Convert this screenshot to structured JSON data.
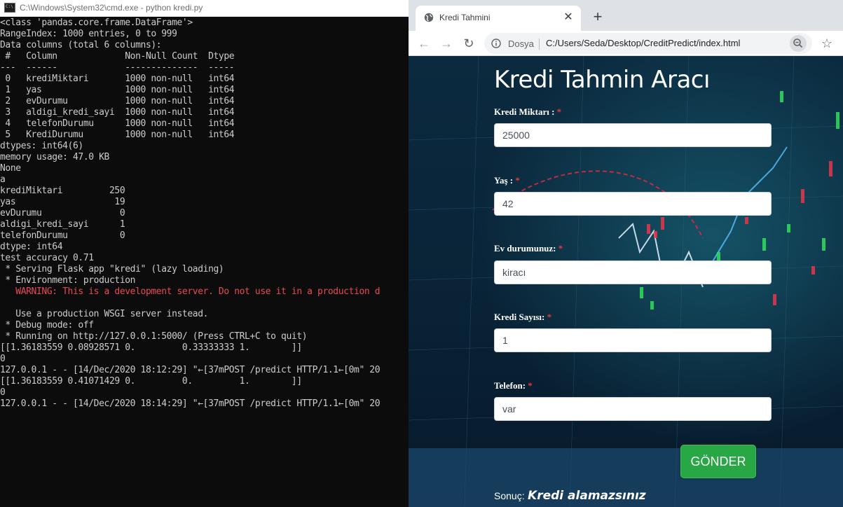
{
  "cmd": {
    "title": "C:\\Windows\\System32\\cmd.exe - python  kredi.py",
    "lines": [
      {
        "text": "<class 'pandas.core.frame.DataFrame'>",
        "type": "normal"
      },
      {
        "text": "RangeIndex: 1000 entries, 0 to 999",
        "type": "normal"
      },
      {
        "text": "Data columns (total 6 columns):",
        "type": "normal"
      },
      {
        "text": " #   Column             Non-Null Count  Dtype",
        "type": "normal"
      },
      {
        "text": "---  ------             --------------  -----",
        "type": "normal"
      },
      {
        "text": " 0   krediMiktari       1000 non-null   int64",
        "type": "normal"
      },
      {
        "text": " 1   yas                1000 non-null   int64",
        "type": "normal"
      },
      {
        "text": " 2   evDurumu           1000 non-null   int64",
        "type": "normal"
      },
      {
        "text": " 3   aldigi_kredi_sayi  1000 non-null   int64",
        "type": "normal"
      },
      {
        "text": " 4   telefonDurumu      1000 non-null   int64",
        "type": "normal"
      },
      {
        "text": " 5   KrediDurumu        1000 non-null   int64",
        "type": "normal"
      },
      {
        "text": "dtypes: int64(6)",
        "type": "normal"
      },
      {
        "text": "memory usage: 47.0 KB",
        "type": "normal"
      },
      {
        "text": "None",
        "type": "normal"
      },
      {
        "text": "a",
        "type": "normal"
      },
      {
        "text": "krediMiktari         250",
        "type": "normal"
      },
      {
        "text": "yas                   19",
        "type": "normal"
      },
      {
        "text": "evDurumu               0",
        "type": "normal"
      },
      {
        "text": "aldigi_kredi_sayi      1",
        "type": "normal"
      },
      {
        "text": "telefonDurumu          0",
        "type": "normal"
      },
      {
        "text": "dtype: int64",
        "type": "normal"
      },
      {
        "text": "test accuracy 0.71",
        "type": "normal"
      },
      {
        "text": " * Serving Flask app \"kredi\" (lazy loading)",
        "type": "normal"
      },
      {
        "text": " * Environment: production",
        "type": "normal"
      },
      {
        "text": "   WARNING: This is a development server. Do not use it in a production d",
        "type": "warn"
      },
      {
        "text": "",
        "type": "normal"
      },
      {
        "text": "   Use a production WSGI server instead.",
        "type": "normal"
      },
      {
        "text": " * Debug mode: off",
        "type": "normal"
      },
      {
        "text": " * Running on http://127.0.0.1:5000/ (Press CTRL+C to quit)",
        "type": "normal"
      },
      {
        "text": "[[1.36183559 0.08928571 0.         0.33333333 1.        ]]",
        "type": "normal"
      },
      {
        "text": "0",
        "type": "normal"
      },
      {
        "text": "127.0.0.1 - - [14/Dec/2020 18:12:29] \"←[37mPOST /predict HTTP/1.1←[0m\" 20",
        "type": "normal"
      },
      {
        "text": "[[1.36183559 0.41071429 0.         0.         1.        ]]",
        "type": "normal"
      },
      {
        "text": "0",
        "type": "normal"
      },
      {
        "text": "127.0.0.1 - - [14/Dec/2020 18:14:29] \"←[37mPOST /predict HTTP/1.1←[0m\" 20",
        "type": "normal"
      }
    ]
  },
  "browser": {
    "tab_title": "Kredi Tahmini",
    "close_glyph": "✕",
    "newtab_glyph": "+",
    "back_glyph": "←",
    "forward_glyph": "→",
    "reload_glyph": "↻",
    "star_glyph": "☆",
    "dosya_label": "Dosya",
    "url": "C:/Users/Seda/Desktop/CreditPredict/index.html"
  },
  "page": {
    "title": "Kredi Tahmin Aracı",
    "fields": {
      "kredi_miktari": {
        "label": "Kredi Miktarı :",
        "value": "25000"
      },
      "yas": {
        "label": "Yaş :",
        "value": "42"
      },
      "ev_durumu": {
        "label": "Ev durumunuz:",
        "value": "kiracı"
      },
      "kredi_sayisi": {
        "label": "Kredi Sayısı:",
        "value": "1"
      },
      "telefon": {
        "label": "Telefon:",
        "value": "var"
      }
    },
    "required_mark": "*",
    "submit_label": "GÖNDER",
    "result_label": "Sonuç:",
    "result_value": "Kredi alamazsınız"
  },
  "colors": {
    "cmd_background": "#0c0c0c",
    "cmd_text": "#cccccc",
    "cmd_warning": "#e74856",
    "submit_button": "#28a745",
    "required_star": "#e53935"
  },
  "icons": [
    "cmd-app-icon",
    "globe-icon",
    "close-icon",
    "plus-icon",
    "back-arrow-icon",
    "forward-arrow-icon",
    "reload-icon",
    "info-icon",
    "zoom-icon",
    "star-icon"
  ]
}
